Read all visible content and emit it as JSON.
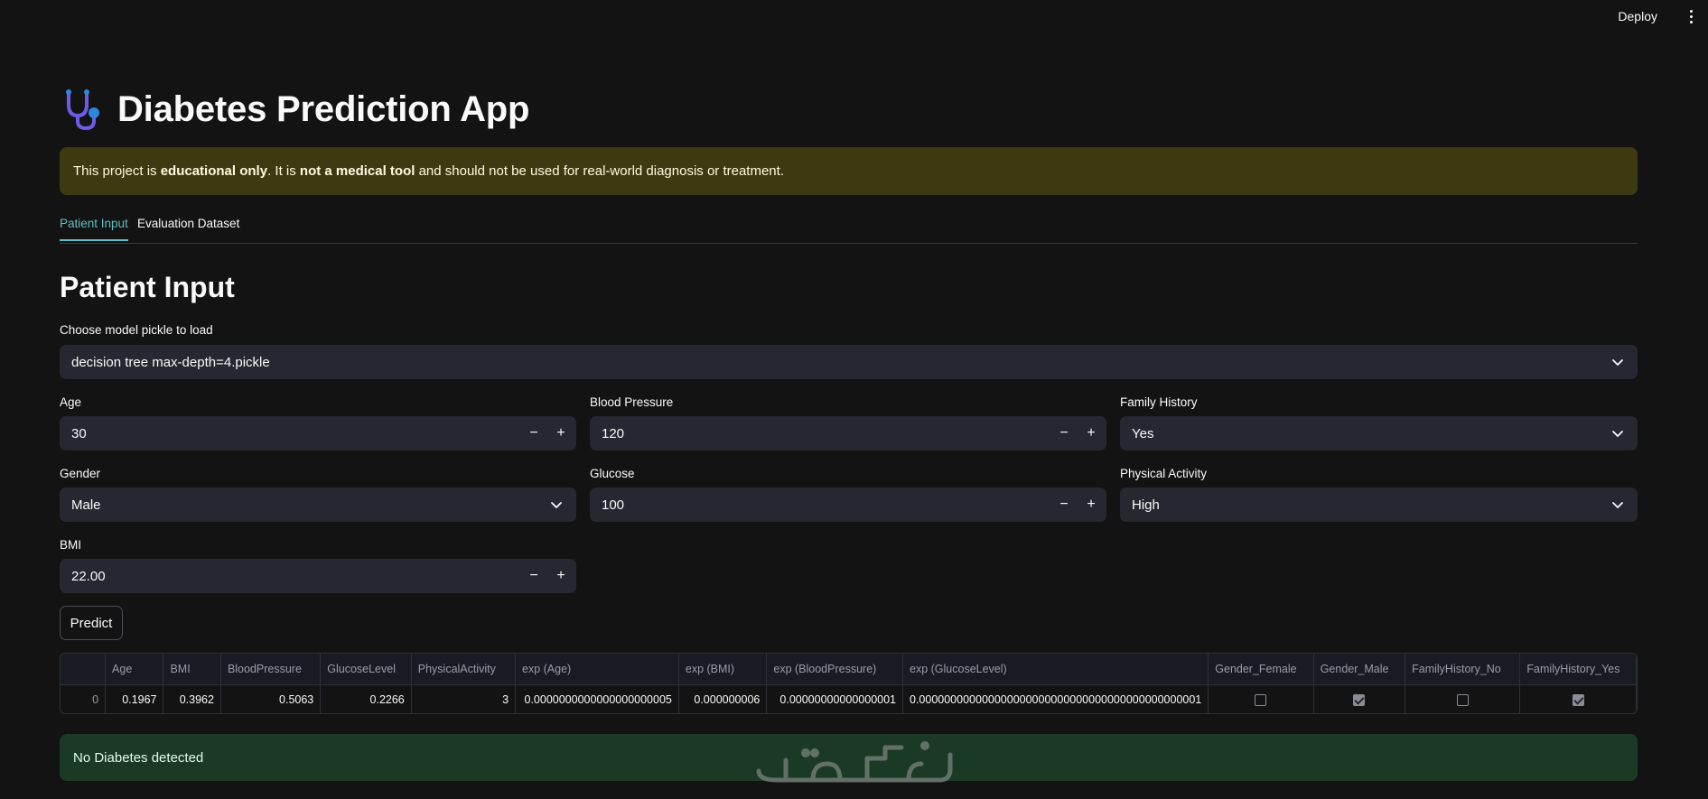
{
  "topbar": {
    "deploy_label": "Deploy",
    "menu_icon": "kebab-menu-icon"
  },
  "app": {
    "title": "Diabetes Prediction App",
    "title_icon": "stethoscope-icon"
  },
  "warning": {
    "prefix": "This project is ",
    "bold1": "educational only",
    "middle": ". It is ",
    "bold2": "not a medical tool",
    "suffix": " and should not be used for real-world diagnosis or treatment."
  },
  "tabs": [
    {
      "label": "Patient Input",
      "active": true
    },
    {
      "label": "Evaluation Dataset",
      "active": false
    }
  ],
  "section": {
    "title": "Patient Input"
  },
  "model_select": {
    "label": "Choose model pickle to load",
    "value": "decision tree max-depth=4.pickle"
  },
  "inputs": {
    "age": {
      "label": "Age",
      "value": "30"
    },
    "blood_pressure": {
      "label": "Blood Pressure",
      "value": "120"
    },
    "family_history": {
      "label": "Family History",
      "value": "Yes"
    },
    "gender": {
      "label": "Gender",
      "value": "Male"
    },
    "glucose": {
      "label": "Glucose",
      "value": "100"
    },
    "physical_activity": {
      "label": "Physical Activity",
      "value": "High"
    },
    "bmi": {
      "label": "BMI",
      "value": "22.00"
    },
    "stepper_minus": "−",
    "stepper_plus": "+"
  },
  "predict_button": {
    "label": "Predict"
  },
  "table": {
    "columns": [
      "",
      "Age",
      "BMI",
      "BloodPressure",
      "GlucoseLevel",
      "PhysicalActivity",
      "exp (Age)",
      "exp (BMI)",
      "exp (BloodPressure)",
      "exp (GlucoseLevel)",
      "Gender_Female",
      "Gender_Male",
      "FamilyHistory_No",
      "FamilyHistory_Yes"
    ],
    "row": {
      "index": "0",
      "age": "0.1967",
      "bmi": "0.3962",
      "blood_pressure": "0.5063",
      "glucose_level": "0.2266",
      "physical_activity": "3",
      "exp_age": "0.0000000000000000000005",
      "exp_bmi": "0.000000006",
      "exp_blood_pressure": "0.00000000000000001",
      "exp_glucose_level": "0.000000000000000000000000000000000000000000001",
      "gender_female": false,
      "gender_male": true,
      "family_history_no": false,
      "family_history_yes": true
    }
  },
  "result": {
    "text": "No Diabetes detected"
  },
  "colors": {
    "accent": "#5fbfc7",
    "warning_bg": "#3d3a12",
    "success_bg": "#1b3a26",
    "background": "#131313",
    "input_bg": "#262730"
  }
}
